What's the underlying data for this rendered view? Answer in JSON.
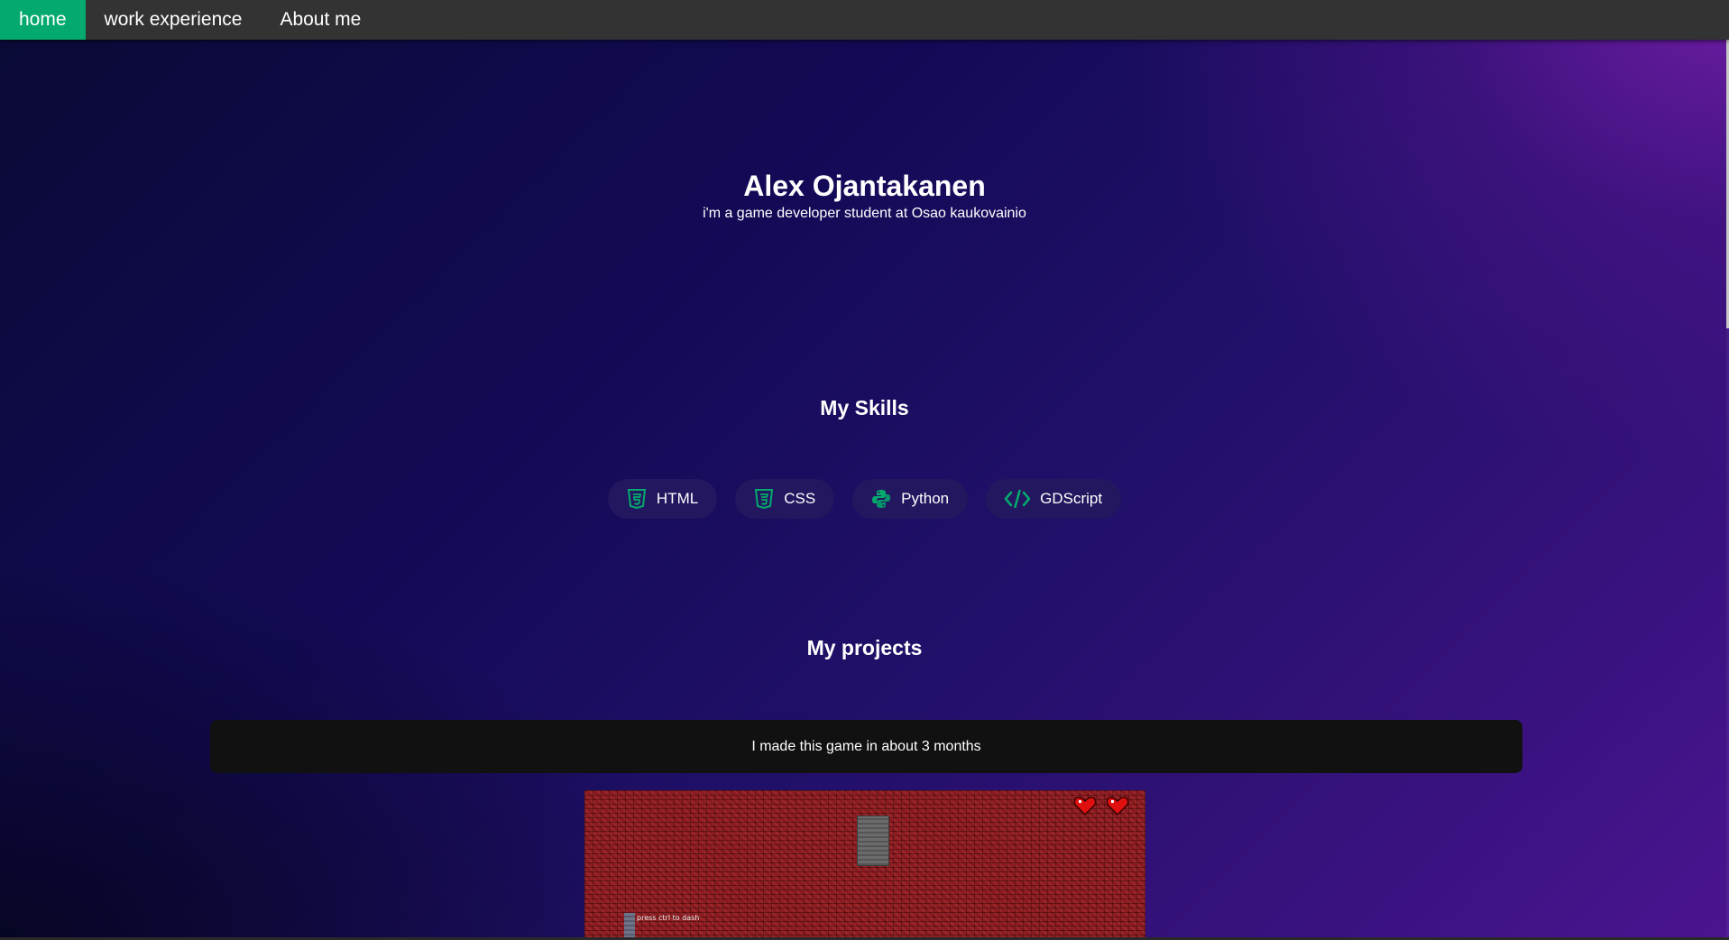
{
  "nav": {
    "items": [
      {
        "label": "home",
        "active": true
      },
      {
        "label": "work experience",
        "active": false
      },
      {
        "label": "About me",
        "active": false
      }
    ],
    "active_color": "#04aa6d"
  },
  "hero": {
    "title": "Alex Ojantakanen",
    "subtitle": "i'm a game developer student at Osao kaukovainio"
  },
  "skills": {
    "title": "My Skills",
    "items": [
      {
        "label": "HTML",
        "icon": "html5-icon"
      },
      {
        "label": "CSS",
        "icon": "css3-icon"
      },
      {
        "label": "Python",
        "icon": "python-icon"
      },
      {
        "label": "GDScript",
        "icon": "code-icon"
      }
    ],
    "icon_color": "#04aa6d"
  },
  "projects": {
    "title": "My projects",
    "banner_text": "I made this game in about 3 months",
    "game": {
      "hint_text": "press ctrl to dash",
      "hearts": 2
    }
  }
}
